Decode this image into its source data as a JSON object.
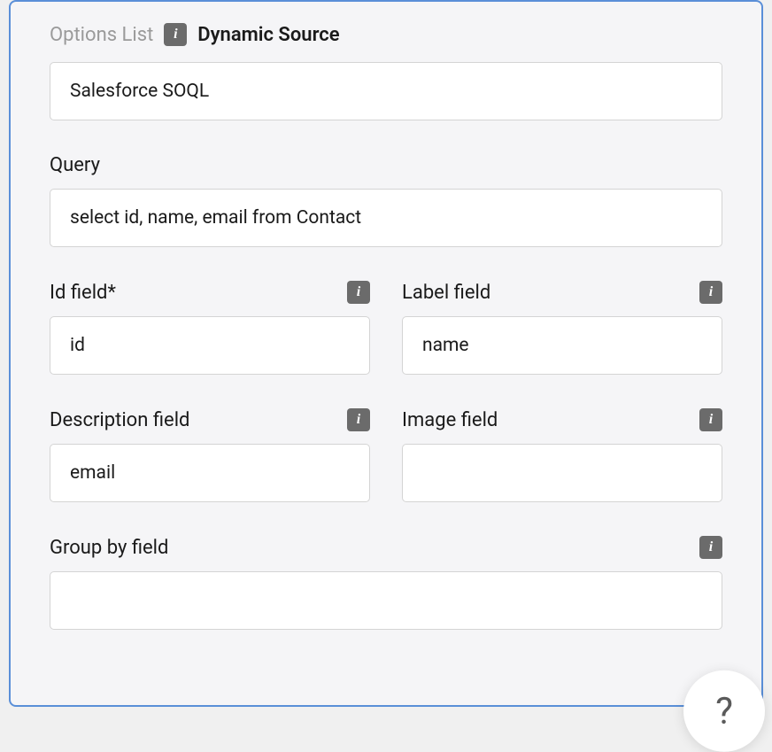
{
  "header": {
    "options_list_label": "Options List",
    "dynamic_source_label": "Dynamic Source"
  },
  "source": {
    "value": "Salesforce SOQL"
  },
  "query": {
    "label": "Query",
    "value": "select id, name, email from Contact"
  },
  "id_field": {
    "label": "Id field*",
    "value": "id"
  },
  "label_field": {
    "label": "Label field",
    "value": "name"
  },
  "description_field": {
    "label": "Description field",
    "value": "email"
  },
  "image_field": {
    "label": "Image field",
    "value": ""
  },
  "group_by_field": {
    "label": "Group by field",
    "value": ""
  },
  "help": {
    "glyph": "?"
  }
}
